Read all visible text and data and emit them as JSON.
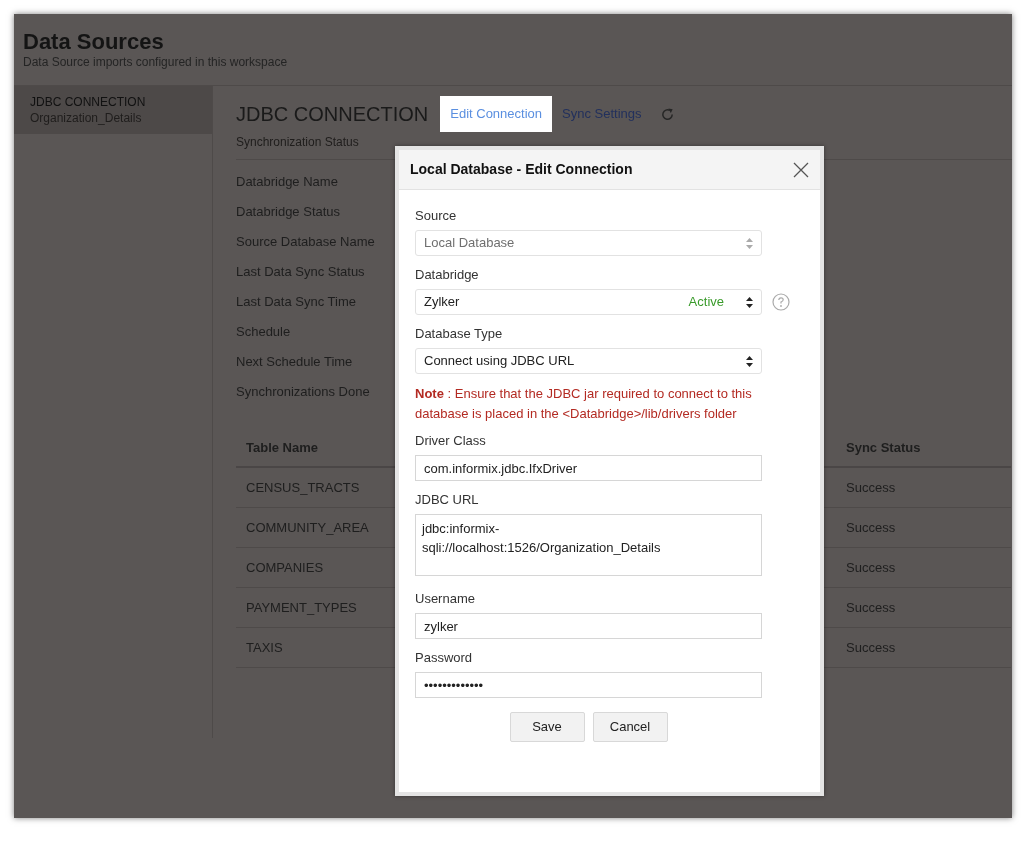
{
  "page": {
    "title": "Data Sources",
    "subtitle": "Data Source imports configured in this workspace"
  },
  "sidebar": {
    "items": [
      {
        "title": "JDBC CONNECTION",
        "subtitle": "Organization_Details",
        "selected": true
      }
    ]
  },
  "main": {
    "heading": "JDBC CONNECTION",
    "tabs": [
      {
        "kind": "link",
        "label": "Edit Connection",
        "selected": true
      },
      {
        "kind": "link",
        "label": "Sync Settings",
        "selected": false
      },
      {
        "kind": "refresh",
        "selected": false
      }
    ],
    "section_label": "Synchronization Status",
    "info_labels": [
      "Databridge Name",
      "Databridge Status",
      "Source Database Name",
      "Last Data Sync Status",
      "Last Data Sync Time",
      "Schedule",
      "Next Schedule Time",
      "Synchronizations Done"
    ],
    "table": {
      "columns": [
        "Table Name",
        "Sync Status"
      ],
      "rows": [
        [
          "CENSUS_TRACTS",
          "Success"
        ],
        [
          "COMMUNITY_AREA",
          "Success"
        ],
        [
          "COMPANIES",
          "Success"
        ],
        [
          "PAYMENT_TYPES",
          "Success"
        ],
        [
          "TAXIS",
          "Success"
        ]
      ]
    }
  },
  "dialog": {
    "title": "Local Database - Edit Connection",
    "fields": [
      {
        "kind": "select",
        "label": "Source",
        "value": "Local Database",
        "disabled": true
      },
      {
        "kind": "select",
        "label": "Databridge",
        "value": "Zylker",
        "status": "Active",
        "disabled": false,
        "help": true
      },
      {
        "kind": "select",
        "label": "Database Type",
        "value": "Connect using JDBC URL",
        "disabled": false
      },
      {
        "kind": "note",
        "text": "**Note** : Ensure that the JDBC jar required to connect to this database is placed in the <Databridge>/lib/drivers folder"
      },
      {
        "kind": "input",
        "label": "Driver Class",
        "value": "com.informix.jdbc.IfxDriver"
      },
      {
        "kind": "textarea",
        "label": "JDBC URL",
        "value": "jdbc:informix-sqli://localhost:1526/Organization_Details"
      },
      {
        "kind": "input",
        "label": "Username",
        "value": "zylker"
      },
      {
        "kind": "password",
        "label": "Password",
        "value": "•••••••••••••"
      }
    ],
    "buttons": [
      "Save",
      "Cancel"
    ]
  }
}
